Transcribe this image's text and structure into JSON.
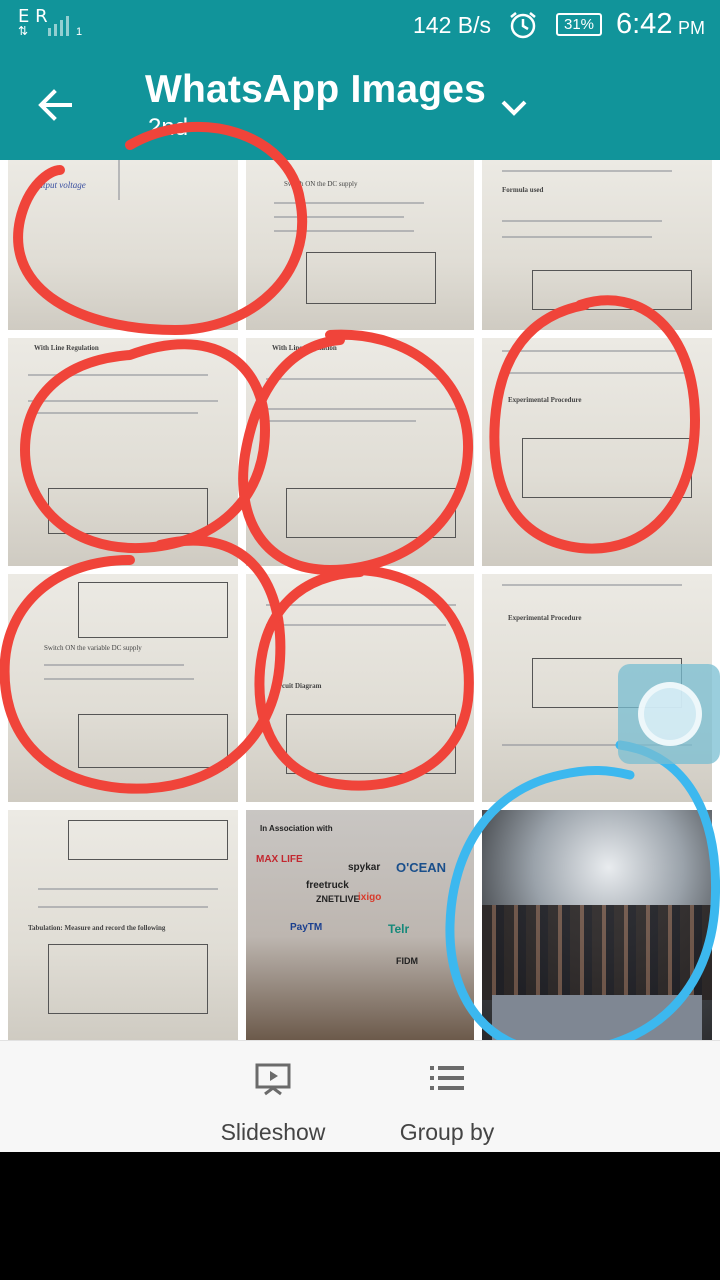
{
  "status_bar": {
    "carrier": "E R",
    "sim_slot": "1",
    "net_speed": "142 B/s",
    "battery": "31%",
    "time": "6:42",
    "ampm": "PM",
    "icons": [
      "data-arrows-icon",
      "signal-icon",
      "alarm-icon",
      "battery-icon"
    ]
  },
  "app_bar": {
    "title": "WhatsApp Images",
    "subtitle": "2nd",
    "icons": [
      "back-arrow-icon",
      "chevron-down-icon"
    ]
  },
  "grid": {
    "thumbnails": [
      {
        "kind": "document",
        "caption": "output voltage"
      },
      {
        "kind": "document",
        "caption": "Switch ON the DC supply"
      },
      {
        "kind": "document",
        "caption": "Formula used"
      },
      {
        "kind": "document",
        "caption": "With Line Regulation"
      },
      {
        "kind": "document",
        "caption": "With Line Regulation"
      },
      {
        "kind": "document",
        "caption": "Experimental Procedure"
      },
      {
        "kind": "document",
        "caption": "Switch ON the variable DC supply"
      },
      {
        "kind": "document",
        "caption": "Circuit Diagram"
      },
      {
        "kind": "document",
        "caption": "Experimental Procedure"
      },
      {
        "kind": "document",
        "caption": "Tabulation: Measure and record the following"
      },
      {
        "kind": "photo",
        "caption": "In Association with"
      },
      {
        "kind": "photo",
        "caption": ""
      }
    ],
    "event_banner": [
      "In Association with",
      "MAX LIFE",
      "freetruck",
      "spykar",
      "O'CEAN",
      "ZNETLIVE",
      "ixigo",
      "PayTM",
      "Telr",
      "FIDM"
    ]
  },
  "annotations": {
    "red_color": "#f0443a",
    "blue_color": "#3cb8ef"
  },
  "bottom_bar": {
    "slideshow_label": "Slideshow",
    "groupby_label": "Group by",
    "icons": [
      "slideshow-icon",
      "list-icon"
    ]
  },
  "colors": {
    "accent": "#11949a"
  }
}
